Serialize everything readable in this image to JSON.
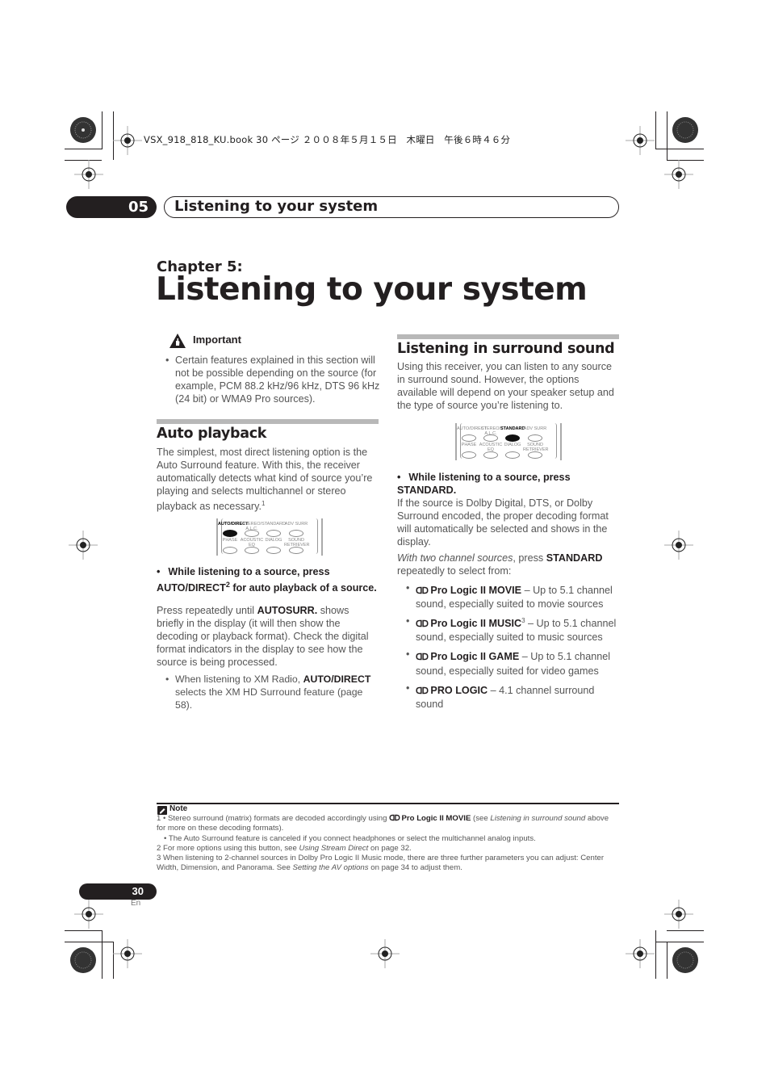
{
  "print_header": "VSX_918_818_KU.book  30 ページ  ２００８年５月１５日　木曜日　午後６時４６分",
  "chapter_tab": {
    "number": "05",
    "title": "Listening to your system"
  },
  "chapter_heading": {
    "label": "Chapter 5:",
    "title": "Listening to your system"
  },
  "important": {
    "heading": "Important",
    "icon": "warning-hand-icon",
    "bullets": [
      "Certain features explained in this section will not be possible depending on the source (for example, PCM 88.2 kHz/96 kHz, DTS 96 kHz (24 bit) or WMA9 Pro sources)."
    ]
  },
  "auto_playback": {
    "heading": "Auto playback",
    "body": "The simplest, most direct listening option is the Auto Surround feature. With this, the receiver automatically detects what kind of source you’re playing and selects multichannel or stereo playback as necessary.",
    "body_footnote": "1",
    "remote": {
      "row1": [
        "AUTO/DIRECT",
        "STEREO/ A.L.C.",
        "STANDARD",
        "ADV SURR"
      ],
      "row2": [
        "PHASE",
        "ACOUSTIC EQ",
        "DIALOG",
        "SOUND RETRIEVER"
      ],
      "highlighted": "AUTO/DIRECT"
    },
    "instruction_pre": "While listening to a source, press AUTO/DIRECT",
    "instruction_sup": "2",
    "instruction_post": " for auto playback of a source.",
    "detail_pre": "Press repeatedly until ",
    "detail_bold": "AUTOSURR.",
    "detail_post": " shows briefly in the display (it will then show the decoding or playback format). Check the digital format indicators in the display to see how the source is being processed.",
    "sub_bullet_pre": "When listening to XM Radio, ",
    "sub_bullet_bold": "AUTO/DIRECT",
    "sub_bullet_post": " selects the XM HD Surround feature (page 58)."
  },
  "surround": {
    "heading": "Listening in surround sound",
    "body": "Using this receiver, you can listen to any source in surround sound. However, the options available will depend on your speaker setup and the type of source you’re listening to.",
    "remote": {
      "row1": [
        "AUTO/DIRECT",
        "STEREO/ A.L.C.",
        "STANDARD",
        "ADV SURR"
      ],
      "row2": [
        "PHASE",
        "ACOUSTIC EQ",
        "DIALOG",
        "SOUND RETRIEVER"
      ],
      "highlighted": "STANDARD"
    },
    "instruction": "While listening to a source, press STANDARD.",
    "detail": "If the source is Dolby Digital, DTS, or Dolby Surround encoded, the proper decoding format will automatically be selected and shows in the display.",
    "two_channel_italic": "With two channel sources",
    "two_channel_mid": ", press ",
    "two_channel_bold": "STANDARD",
    "two_channel_post": " repeatedly to select from:",
    "dolby_symbol": "ᗡᗞ",
    "modes": [
      {
        "name": "Pro Logic II MOVIE",
        "sup": "",
        "desc": " – Up to 5.1 channel sound, especially suited to movie sources"
      },
      {
        "name": "Pro Logic II MUSIC",
        "sup": "3",
        "desc": " – Up to 5.1 channel sound, especially suited to music sources"
      },
      {
        "name": "Pro Logic II GAME",
        "sup": "",
        "desc": " – Up to 5.1 channel sound, especially suited for video games"
      },
      {
        "name": "PRO LOGIC",
        "sup": "",
        "desc": " – 4.1 channel surround sound"
      }
    ]
  },
  "notes": {
    "heading": "Note",
    "n1a_pre": "1  • Stereo surround (matrix) formats are decoded accordingly using ",
    "n1a_bold": "Pro Logic II MOVIE",
    "n1a_mid": " (see ",
    "n1a_italic": "Listening in surround sound",
    "n1a_post": " above for more on these decoding formats).",
    "n1b": "• The Auto Surround feature is canceled if you connect headphones or select the multichannel analog inputs.",
    "n2_pre": "2  For more options using this button, see ",
    "n2_italic": "Using Stream Direct",
    "n2_post": " on page 32.",
    "n3_pre": "3  When listening to 2-channel sources in Dolby Pro Logic II Music mode, there are three further parameters you can adjust: Center Width, Dimension, and Panorama. See ",
    "n3_italic": "Setting the AV options",
    "n3_post": " on page 34 to adjust them."
  },
  "footer": {
    "page_number": "30",
    "language": "En"
  }
}
